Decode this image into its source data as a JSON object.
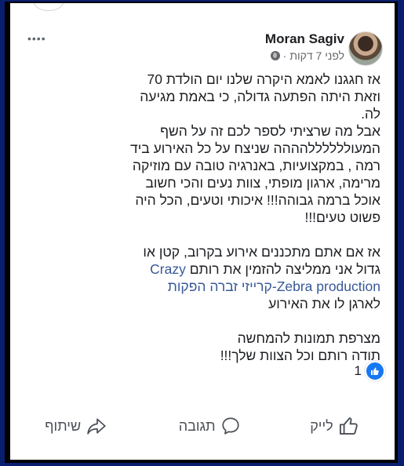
{
  "post": {
    "author": "Moran Sagiv",
    "time": "לפני 7 דקות",
    "separator": "·",
    "menu_label": "••••",
    "paragraph1": [
      "אז חגגנו לאמא היקרה שלנו יום הולדת 70",
      "וזאת היתה הפתעה גדולה, כי באמת מגיעה",
      "לה.",
      "אבל מה שרציתי לספר לכם זה על השף",
      "המעוללללללהההה שניצח על כל האירוע ביד",
      "רמה , במקצועיות, באנרגיה טובה עם מוזיקה",
      "מרימה, ארגון מופתי, צוות נעים והכי חשוב",
      "אוכל ברמה גבוהה!!! איכותי וטעים, הכל היה",
      "פשוט טעים!!!"
    ],
    "paragraph2_line1": "אז אם אתם מתכננים אירוע בקרוב, קטן או",
    "paragraph2_line2_prefix": "גדול אני ממליצה להזמין את רותם ",
    "paragraph2_link_a": "Crazy",
    "paragraph2_link_b": "Zebra production-קרייזי זברה הפקות",
    "paragraph2_line4": "לארגן לו את האירוע",
    "paragraph3": [
      "מצרפת תמונות להמחשה",
      "תודה רותם וכל הצוות שלך!!!"
    ],
    "like_count": "1"
  },
  "actions": {
    "like": "לייק",
    "comment": "תגובה",
    "share": "שיתוף"
  },
  "colors": {
    "frame": "#0a1e6e",
    "link": "#385898",
    "like_blue": "#1877f2"
  }
}
